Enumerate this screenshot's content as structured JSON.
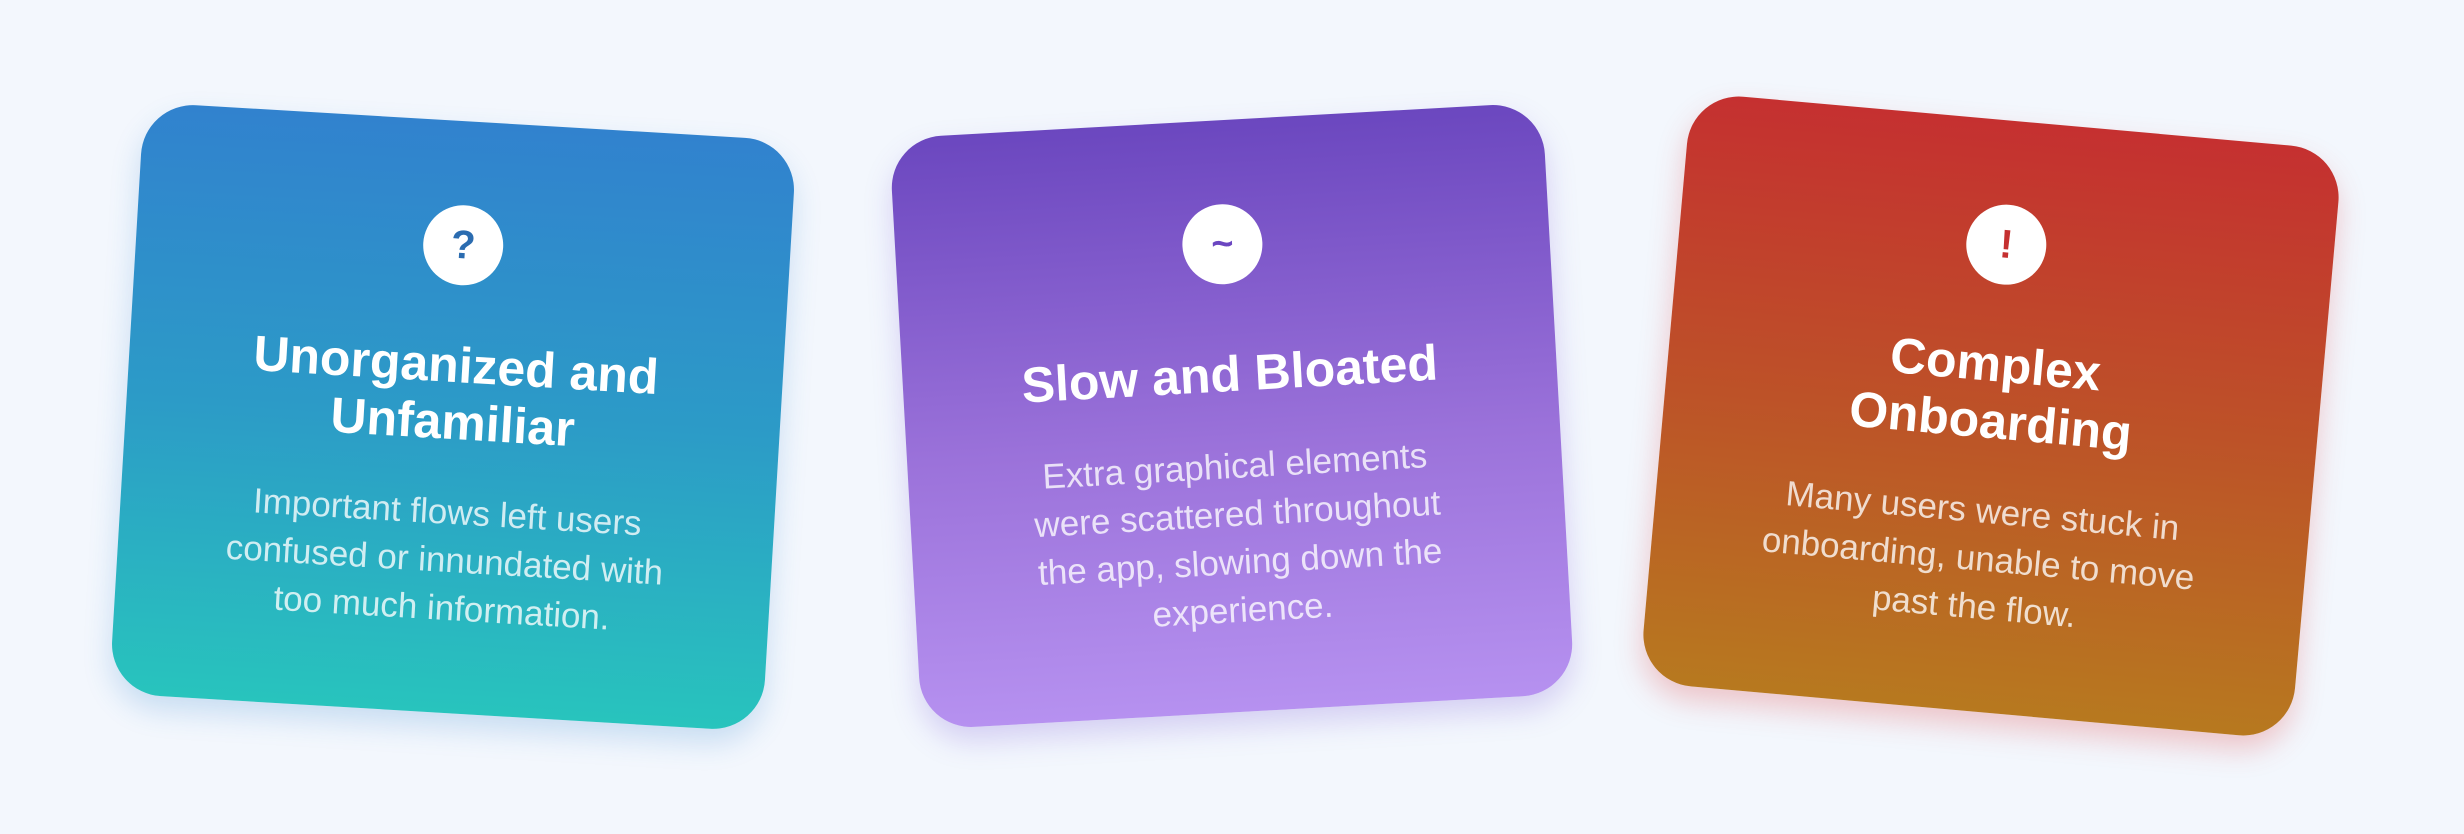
{
  "cards": [
    {
      "icon_name": "question-mark-icon",
      "icon_glyph": "?",
      "title_line1": "Unorganized and",
      "title_line2": "Unfamiliar",
      "description_line1": "Important flows left users",
      "description_line2": "confused or innundated with",
      "description_line3": "too much information.",
      "gradient_top": "#3182ce",
      "gradient_bottom": "#28c4bd"
    },
    {
      "icon_name": "tilde-icon",
      "icon_glyph": "~",
      "title_line1": "Slow and Bloated",
      "description_line1": "Extra graphical elements",
      "description_line2": "were scattered throughout",
      "description_line3": "the app, slowing down the",
      "description_line4": "experience.",
      "gradient_top": "#6b47bf",
      "gradient_bottom": "#b691f0"
    },
    {
      "icon_name": "exclamation-icon",
      "icon_glyph": "!",
      "title_line1": "Complex",
      "title_line2": "Onboarding",
      "description_line1": "Many users were stuck in",
      "description_line2": "onboarding, unable to move",
      "description_line3": "past the flow.",
      "gradient_top": "#c53030",
      "gradient_bottom": "#b7791f"
    }
  ]
}
